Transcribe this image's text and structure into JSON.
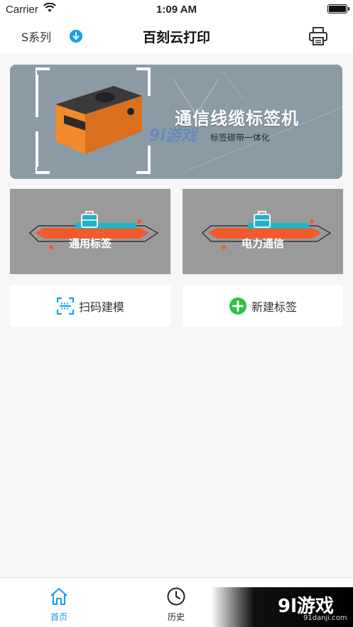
{
  "status_bar": {
    "carrier": "Carrier",
    "time": "1:09 AM"
  },
  "nav": {
    "series_label": "S系列",
    "title": "百刻云打印"
  },
  "banner": {
    "title": "通信线缆标签机",
    "subtitle": "标签碳带一体化"
  },
  "label_cards": [
    {
      "label": "通用标签"
    },
    {
      "label": "电力通信"
    }
  ],
  "actions": {
    "scan_label": "扫码建模",
    "new_label": "新建标签"
  },
  "tabs": [
    {
      "label": "首页",
      "icon": "home-icon",
      "active": true
    },
    {
      "label": "历史",
      "icon": "clock-icon",
      "active": false
    },
    {
      "label": "",
      "icon": "user-icon",
      "active": false
    }
  ],
  "watermark": {
    "text": "9l游戏",
    "sub": "91danji.com"
  },
  "colors": {
    "accent": "#1a9ee8",
    "orange": "#f15a2a",
    "teal": "#22b3c9",
    "green": "#2ec24a",
    "banner_bg": "#8a9ba6"
  }
}
